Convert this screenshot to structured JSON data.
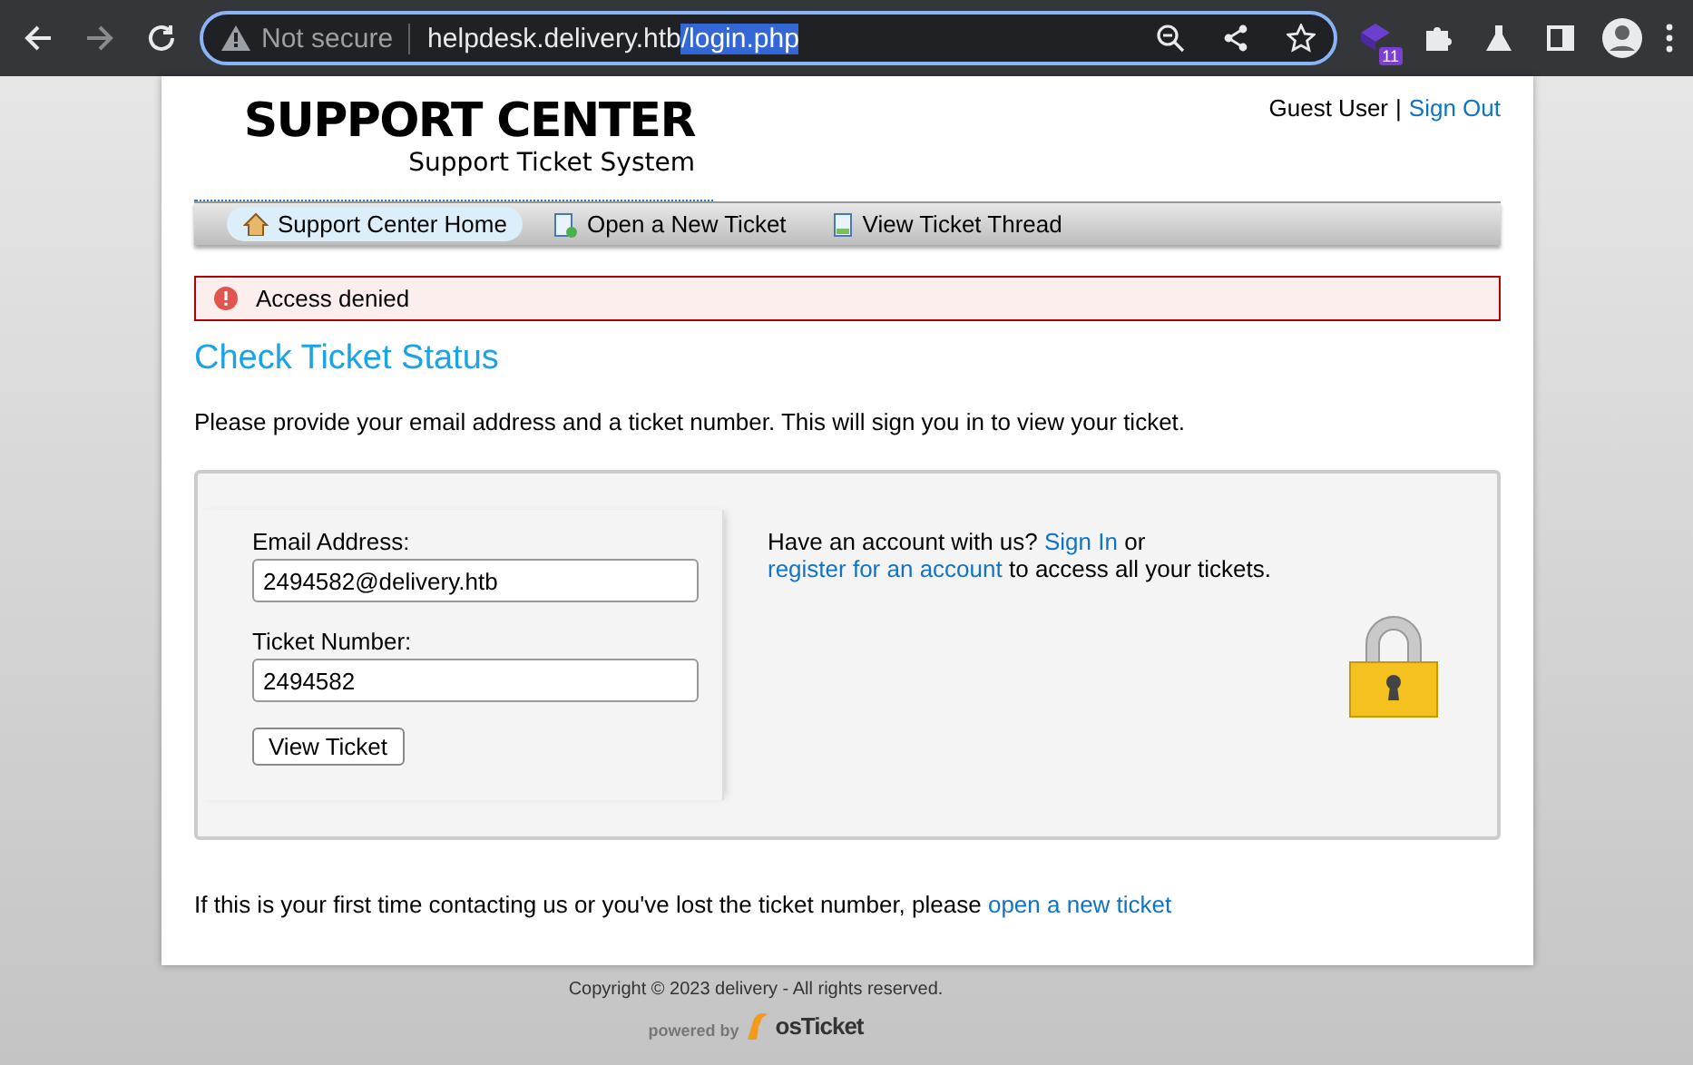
{
  "browser": {
    "back_disabled": false,
    "forward_disabled": true,
    "security_label": "Not secure",
    "url_host": "helpdesk.delivery.htb",
    "url_selected": "/login.php",
    "extension_badge": "11"
  },
  "header": {
    "logo_title": "SUPPORT CENTER",
    "logo_subtitle": "Support Ticket System",
    "user": "Guest User",
    "separator": "|",
    "sign_out": "Sign Out"
  },
  "nav": [
    {
      "label": "Support Center Home",
      "kind": "home",
      "selected": true
    },
    {
      "label": "Open a New Ticket",
      "kind": "new",
      "selected": false
    },
    {
      "label": "View Ticket Thread",
      "kind": "view",
      "selected": false
    }
  ],
  "alert": "Access denied",
  "title": "Check Ticket Status",
  "intro": "Please provide your email address and a ticket number. This will sign you in to view your ticket.",
  "form": {
    "fields": [
      {
        "label": "Email Address:",
        "value": "2494582@delivery.htb"
      },
      {
        "label": "Ticket Number:",
        "value": "2494582"
      }
    ],
    "button": "View Ticket"
  },
  "account": {
    "text_before": "Have an account with us?",
    "sign_in": "Sign In",
    "or": "or",
    "register": "register for an account",
    "text_after": "to access all your tickets."
  },
  "footer_note": {
    "text": "If this is your first time contacting us or you've lost the ticket number, please",
    "link": "open a new ticket"
  },
  "copyright": "Copyright © 2023 delivery - All rights reserved.",
  "powered_by": "powered by",
  "brand": "osTicket"
}
